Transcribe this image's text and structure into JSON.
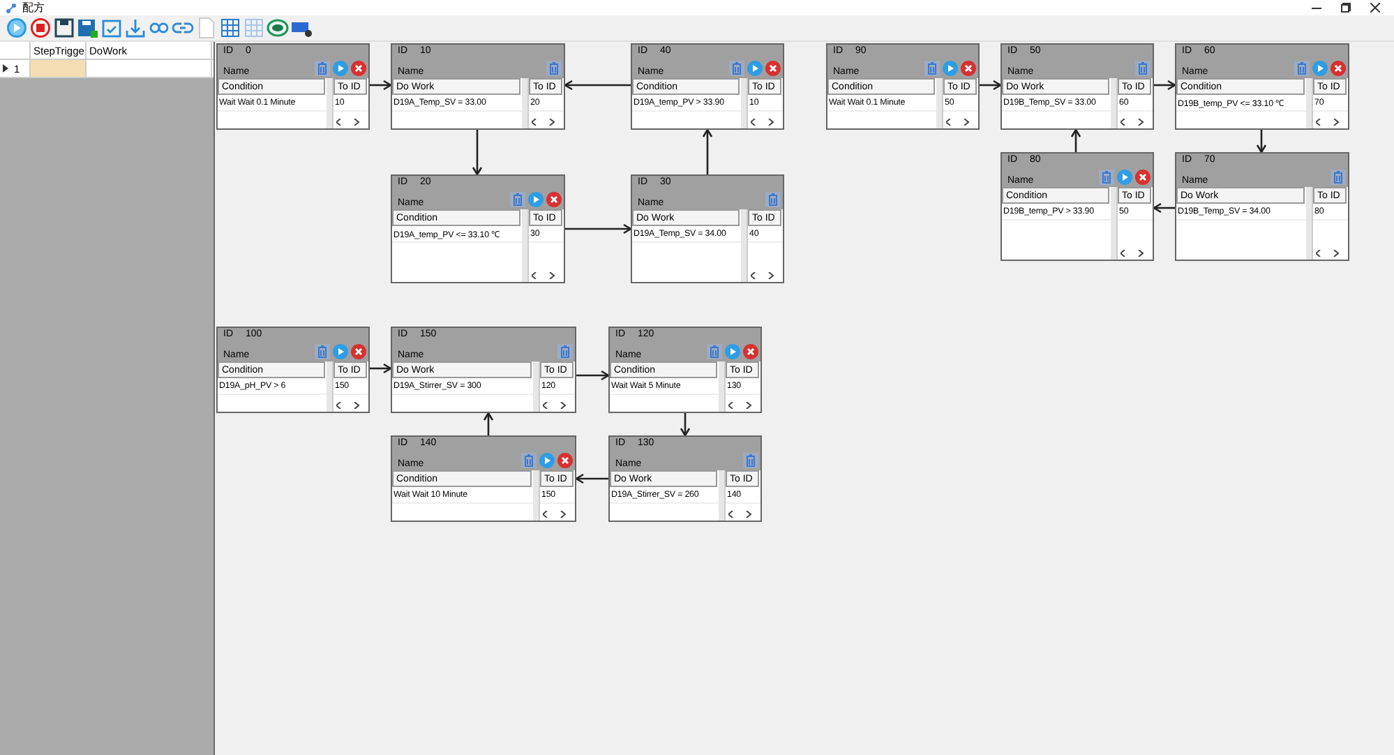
{
  "window": {
    "title": "配方"
  },
  "step_grid": {
    "columns": [
      "StepTrigge",
      "DoWork"
    ],
    "rows": [
      {
        "number": "1",
        "selected": true
      }
    ]
  },
  "nodes": [
    {
      "kind": "condition",
      "id_label": "ID",
      "id": "0",
      "name_label": "Name",
      "column": "Condition",
      "value": "Wait Wait 0.1 Minute",
      "to_id_label": "To ID",
      "to_id": "10"
    },
    {
      "kind": "work",
      "id_label": "ID",
      "id": "10",
      "name_label": "Name",
      "column": "Do Work",
      "value": "D19A_Temp_SV = 33.00",
      "to_id_label": "To ID",
      "to_id": "20"
    },
    {
      "kind": "condition",
      "id_label": "ID",
      "id": "40",
      "name_label": "Name",
      "column": "Condition",
      "value": "D19A_temp_PV > 33.90",
      "to_id_label": "To ID",
      "to_id": "10"
    },
    {
      "kind": "condition",
      "id_label": "ID",
      "id": "20",
      "name_label": "Name",
      "column": "Condition",
      "value": "D19A_temp_PV <= 33.10 ℃",
      "to_id_label": "To ID",
      "to_id": "30"
    },
    {
      "kind": "work",
      "id_label": "ID",
      "id": "30",
      "name_label": "Name",
      "column": "Do Work",
      "value": "D19A_Temp_SV = 34.00",
      "to_id_label": "To ID",
      "to_id": "40"
    },
    {
      "kind": "condition",
      "id_label": "ID",
      "id": "90",
      "name_label": "Name",
      "column": "Condition",
      "value": "Wait Wait 0.1 Minute",
      "to_id_label": "To ID",
      "to_id": "50"
    },
    {
      "kind": "work",
      "id_label": "ID",
      "id": "50",
      "name_label": "Name",
      "column": "Do Work",
      "value": "D19B_Temp_SV = 33.00",
      "to_id_label": "To ID",
      "to_id": "60"
    },
    {
      "kind": "condition",
      "id_label": "ID",
      "id": "60",
      "name_label": "Name",
      "column": "Condition",
      "value": "D19B_temp_PV <= 33.10 ℃",
      "to_id_label": "To ID",
      "to_id": "70"
    },
    {
      "kind": "condition",
      "id_label": "ID",
      "id": "80",
      "name_label": "Name",
      "column": "Condition",
      "value": "D19B_temp_PV > 33.90",
      "to_id_label": "To ID",
      "to_id": "50"
    },
    {
      "kind": "work",
      "id_label": "ID",
      "id": "70",
      "name_label": "Name",
      "column": "Do Work",
      "value": "D19B_Temp_SV = 34.00",
      "to_id_label": "To ID",
      "to_id": "80"
    },
    {
      "kind": "condition",
      "id_label": "ID",
      "id": "100",
      "name_label": "Name",
      "column": "Condition",
      "value": "D19A_pH_PV > 6",
      "to_id_label": "To ID",
      "to_id": "150"
    },
    {
      "kind": "work",
      "id_label": "ID",
      "id": "150",
      "name_label": "Name",
      "column": "Do Work",
      "value": "D19A_Stirrer_SV = 300",
      "to_id_label": "To ID",
      "to_id": "120"
    },
    {
      "kind": "condition",
      "id_label": "ID",
      "id": "120",
      "name_label": "Name",
      "column": "Condition",
      "value": "Wait Wait 5 Minute",
      "to_id_label": "To ID",
      "to_id": "130"
    },
    {
      "kind": "condition",
      "id_label": "ID",
      "id": "140",
      "name_label": "Name",
      "column": "Condition",
      "value": "Wait Wait 10 Minute",
      "to_id_label": "To ID",
      "to_id": "150"
    },
    {
      "kind": "work",
      "id_label": "ID",
      "id": "130",
      "name_label": "Name",
      "column": "Do Work",
      "value": "D19A_Stirrer_SV = 260",
      "to_id_label": "To ID",
      "to_id": "140"
    }
  ]
}
